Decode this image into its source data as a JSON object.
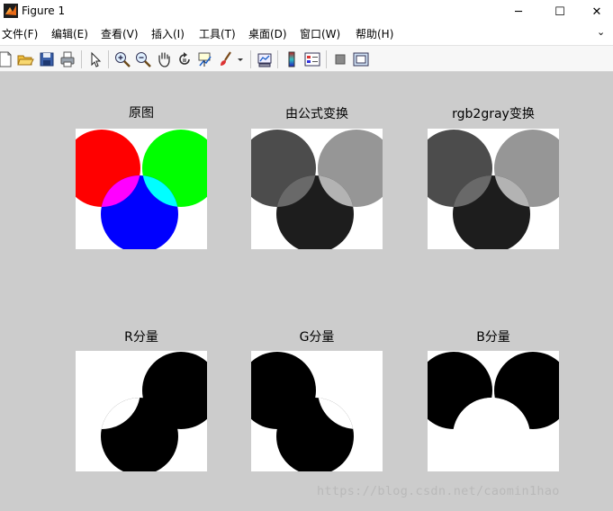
{
  "window": {
    "title": "Figure 1"
  },
  "window_controls": {
    "minimize": "─",
    "maximize": "☐",
    "close": "✕"
  },
  "menu": {
    "items": [
      "文件(F)",
      "编辑(E)",
      "查看(V)",
      "插入(I)",
      "工具(T)",
      "桌面(D)",
      "窗口(W)",
      "帮助(H)"
    ],
    "more": "⌄"
  },
  "toolbar": {
    "icons": [
      "new-figure-icon",
      "open-file-icon",
      "save-icon",
      "print-icon",
      "select-arrow-icon",
      "zoom-in-icon",
      "zoom-out-icon",
      "pan-hand-icon",
      "rotate-3d-icon",
      "data-cursor-icon",
      "brush-icon",
      "link-plot-icon",
      "colorbar-icon",
      "legend-icon",
      "hide-plot-tools-icon",
      "show-plot-tools-icon"
    ]
  },
  "subplots": [
    {
      "title": "原图",
      "colors": {
        "top_left": "#ff0000",
        "top_right": "#00ff00",
        "bottom": "#0000ff",
        "overlap_lr": "#ffff00",
        "overlap_lb": "#ff00ff",
        "overlap_rb": "#00ffff",
        "overlap_all": "#ffffff",
        "background": "#ffffff"
      }
    },
    {
      "title": "由公式变换",
      "colors": {
        "top_left": "#4c4c4c",
        "top_right": "#969696",
        "bottom": "#1d1d1d",
        "overlap_lr": "#e2e2e2",
        "overlap_lb": "#696969",
        "overlap_rb": "#b3b3b3",
        "overlap_all": "#ffffff",
        "background": "#ffffff"
      }
    },
    {
      "title": "rgb2gray变换",
      "colors": {
        "top_left": "#4c4c4c",
        "top_right": "#969696",
        "bottom": "#1d1d1d",
        "overlap_lr": "#e2e2e2",
        "overlap_lb": "#696969",
        "overlap_rb": "#b3b3b3",
        "overlap_all": "#ffffff",
        "background": "#ffffff"
      }
    },
    {
      "title": "R分量",
      "colors": {
        "top_left": "#ffffff",
        "top_right": "#000000",
        "bottom": "#000000",
        "overlap_lr": "#ffffff",
        "overlap_lb": "#ffffff",
        "overlap_rb": "#000000",
        "overlap_all": "#ffffff",
        "background": "#ffffff"
      }
    },
    {
      "title": "G分量",
      "colors": {
        "top_left": "#000000",
        "top_right": "#ffffff",
        "bottom": "#000000",
        "overlap_lr": "#ffffff",
        "overlap_lb": "#000000",
        "overlap_rb": "#ffffff",
        "overlap_all": "#ffffff",
        "background": "#ffffff"
      }
    },
    {
      "title": "B分量",
      "colors": {
        "top_left": "#000000",
        "top_right": "#000000",
        "bottom": "#ffffff",
        "overlap_lr": "#000000",
        "overlap_lb": "#ffffff",
        "overlap_rb": "#ffffff",
        "overlap_all": "#ffffff",
        "background": "#ffffff"
      }
    }
  ],
  "watermark": "https://blog.csdn.net/caomin1hao"
}
